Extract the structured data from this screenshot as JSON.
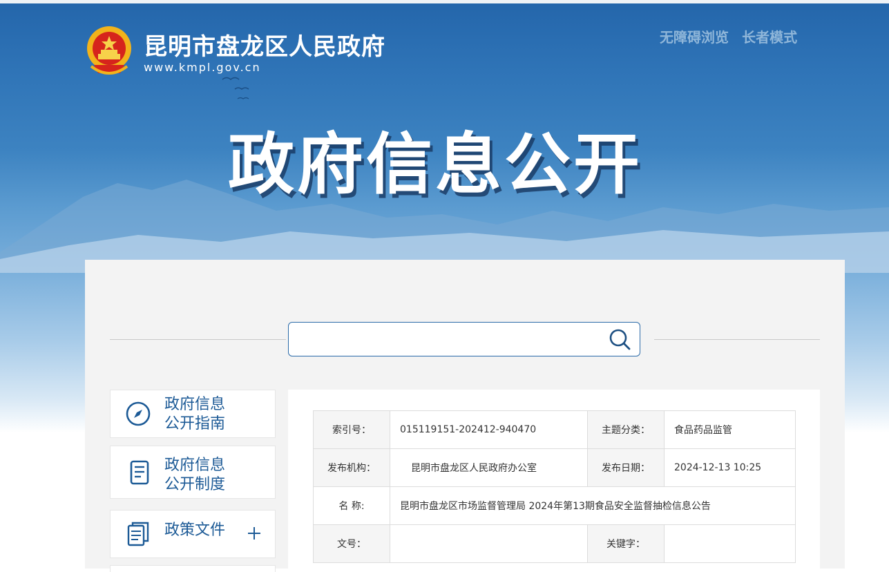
{
  "header": {
    "site_name": "昆明市盘龙区人民政府",
    "site_url": "www.kmpl.gov.cn",
    "links": [
      "无障碍浏览",
      "长者模式"
    ]
  },
  "banner": {
    "title": "政府信息公开"
  },
  "search": {
    "placeholder": "",
    "value": ""
  },
  "sidebar": {
    "items": [
      {
        "line1": "政府信息",
        "line2": "公开指南",
        "icon": "compass-icon"
      },
      {
        "line1": "政府信息",
        "line2": "公开制度",
        "icon": "document-icon"
      },
      {
        "line1": "政策文件",
        "icon": "files-icon",
        "expand": "plus-icon"
      }
    ]
  },
  "info_table": {
    "index_label": "索引号：",
    "index_value": "015119151-202412-940470",
    "topic_label": "主题分类：",
    "topic_value": "食品药品监管",
    "publisher_label": "发布机构：",
    "publisher_value": "昆明市盘龙区人民政府办公室",
    "date_label": "发布日期：",
    "date_value": "2024-12-13 10:25",
    "name_label": "名 称:",
    "name_value": "昆明市盘龙区市场监督管理局 2024年第13期食品安全监督抽检信息公告",
    "docno_label": "文号：",
    "docno_value": "",
    "keyword_label": "关键字：",
    "keyword_value": ""
  },
  "colors": {
    "accent": "#1c5a96",
    "banner_top": "#2466ab"
  }
}
